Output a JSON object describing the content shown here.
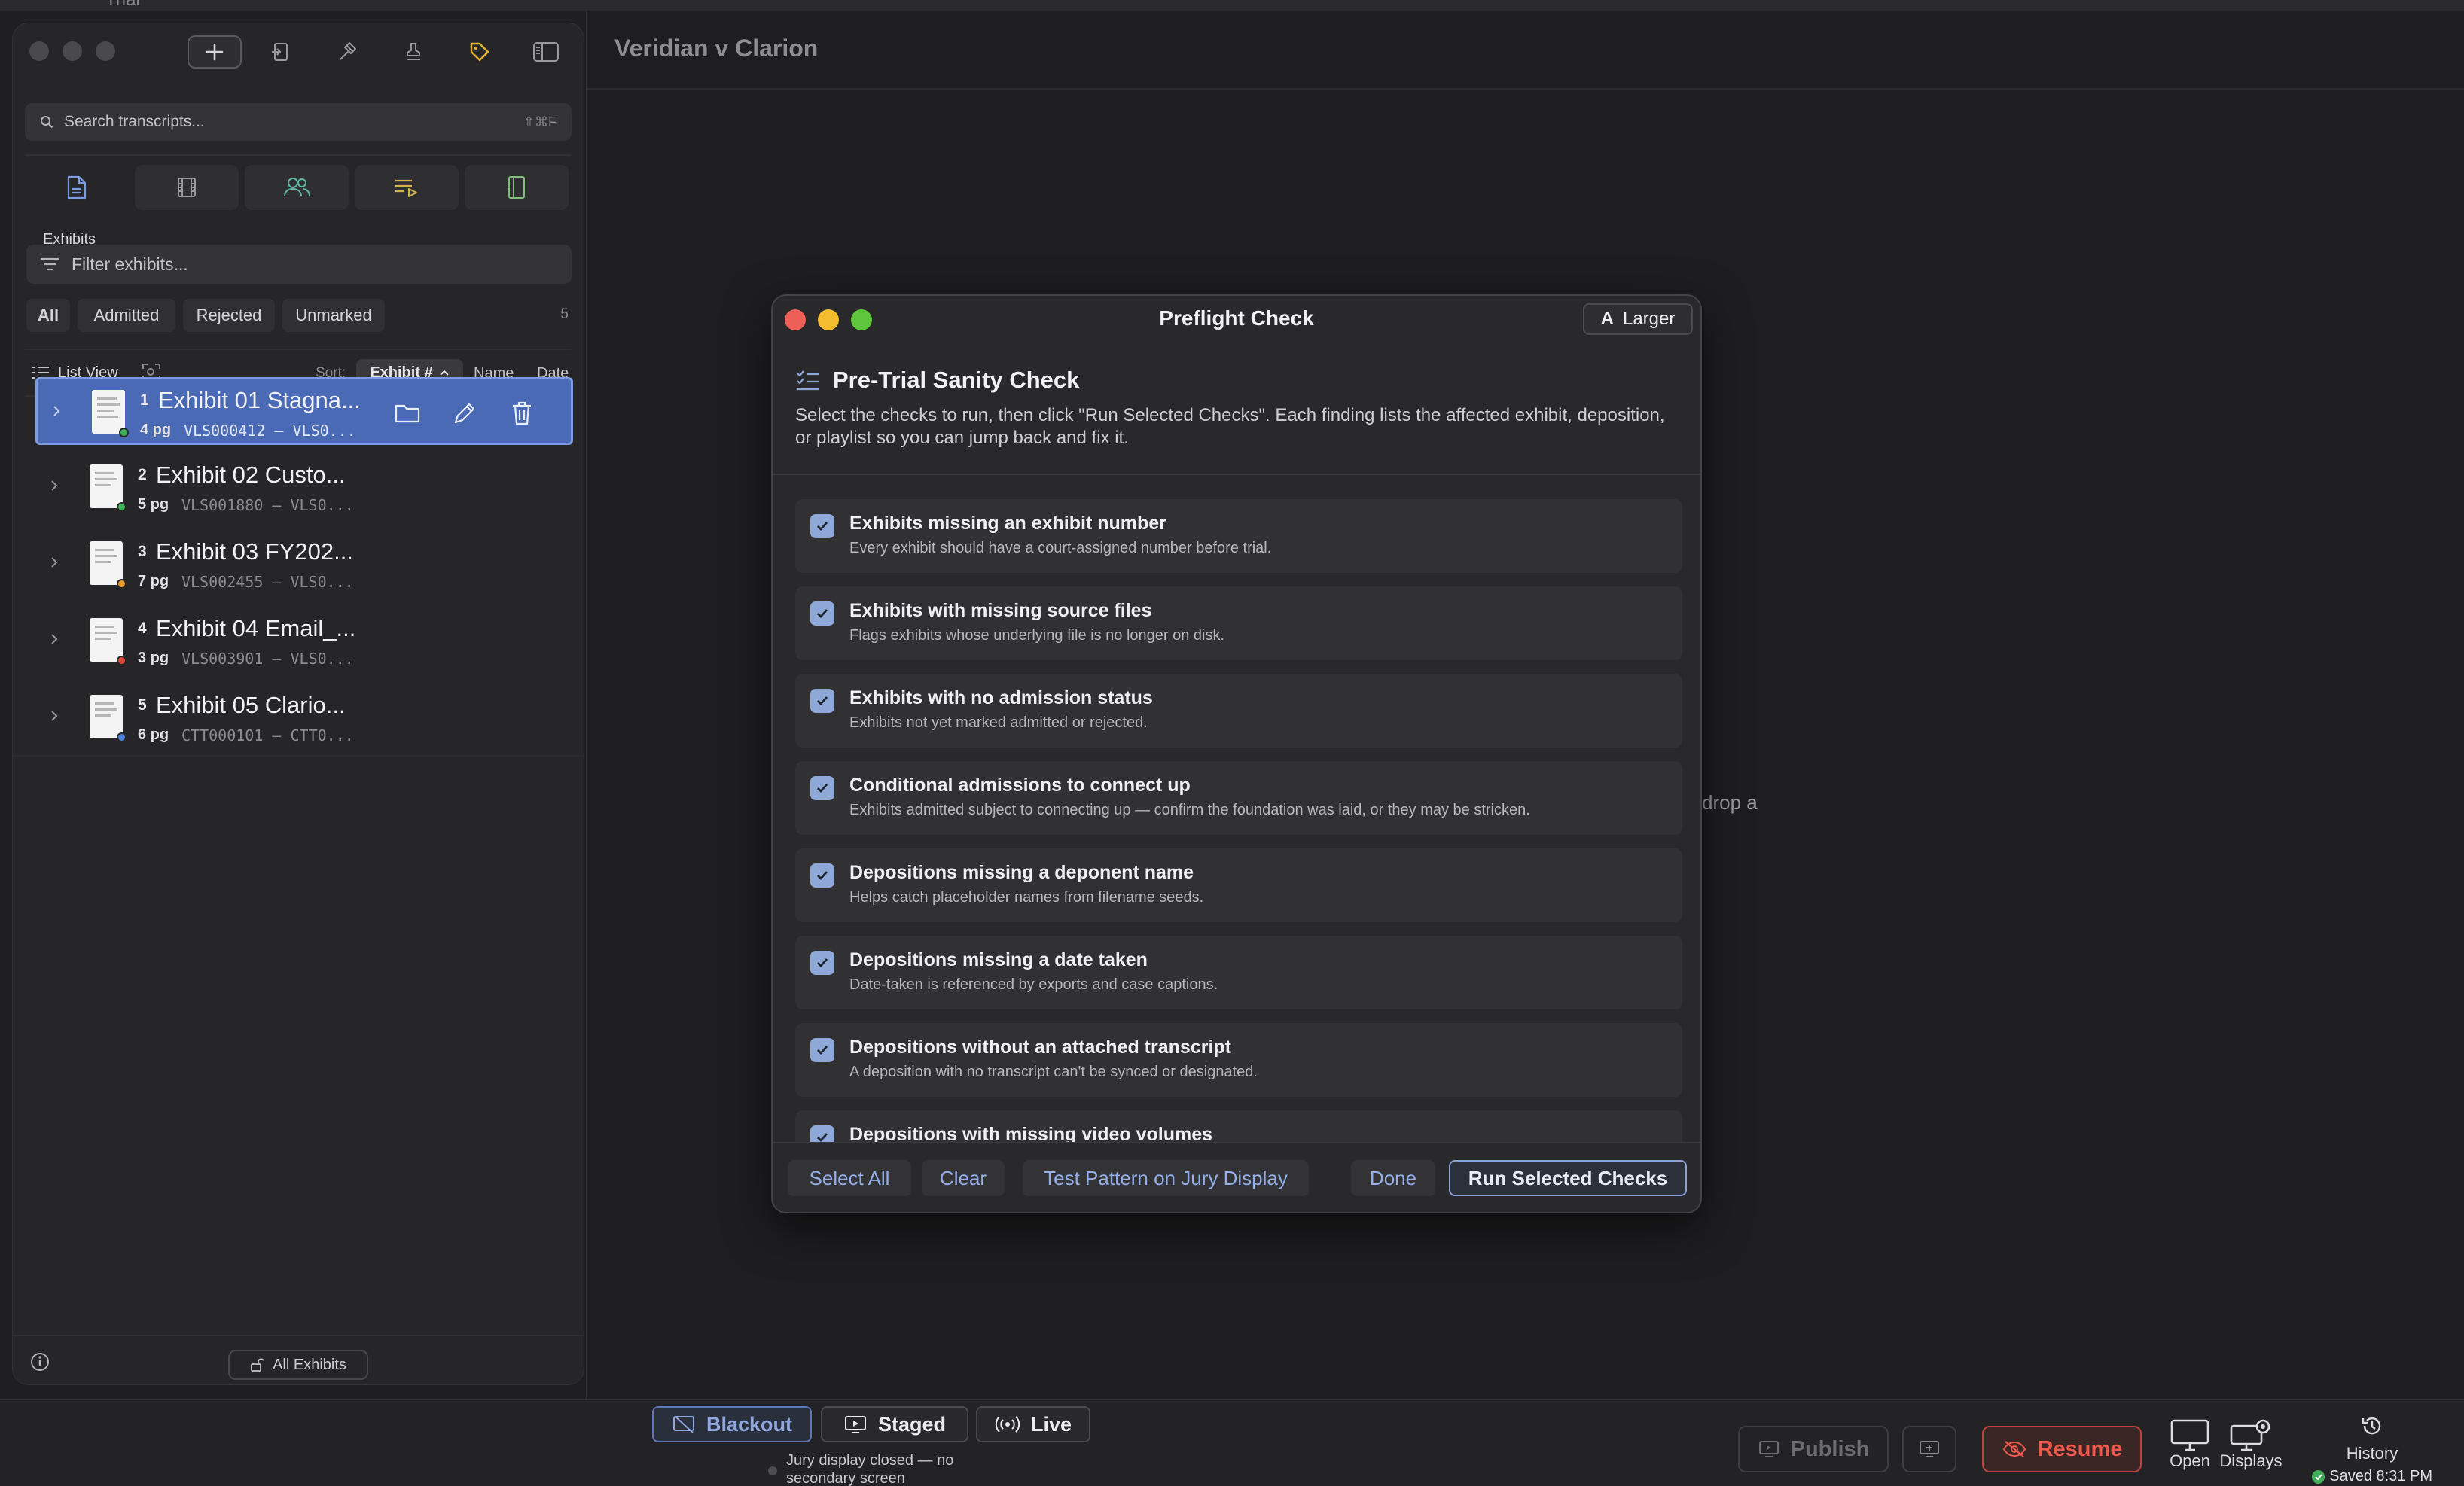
{
  "window": {
    "title_fragment": "Trial"
  },
  "toolbar": {
    "buttons": [
      "add",
      "import",
      "mark",
      "stamp",
      "tag",
      "sidebar-toggle"
    ]
  },
  "search": {
    "placeholder": "Search transcripts...",
    "shortcut": "⇧⌘F"
  },
  "tabs": {
    "active_label": "Exhibits",
    "items": [
      "exhibits",
      "clips",
      "witnesses",
      "playlists",
      "notebook"
    ]
  },
  "filter": {
    "placeholder": "Filter exhibits..."
  },
  "chips": {
    "items": [
      "All",
      "Admitted",
      "Rejected",
      "Unmarked"
    ],
    "count": "5"
  },
  "listbar": {
    "view_label": "List View",
    "sort_label": "Sort:",
    "sort_active": "Exhibit #",
    "sort_name": "Name",
    "sort_date": "Date"
  },
  "exhibits": [
    {
      "num": "1",
      "title": "Exhibit 01 Stagna...",
      "pages": "4 pg",
      "bates": "VLS000412 — VLS0...",
      "status_color": "#3fae58",
      "selected": true
    },
    {
      "num": "2",
      "title": "Exhibit 02 Custo...",
      "pages": "5 pg",
      "bates": "VLS001880 — VLS0...",
      "status_color": "#3fae58",
      "selected": false
    },
    {
      "num": "3",
      "title": "Exhibit 03 FY202...",
      "pages": "7 pg",
      "bates": "VLS002455 — VLS0...",
      "status_color": "#e59a2e",
      "selected": false
    },
    {
      "num": "4",
      "title": "Exhibit 04 Email_...",
      "pages": "3 pg",
      "bates": "VLS003901 — VLS0...",
      "status_color": "#e0443a",
      "selected": false
    },
    {
      "num": "5",
      "title": "Exhibit 05 Clario...",
      "pages": "6 pg",
      "bates": "CTT000101 — CTT0...",
      "status_color": "#4a7fd8",
      "selected": false
    }
  ],
  "sidebar_footer": {
    "all_exhibits": "All Exhibits"
  },
  "main": {
    "title": "Veridian v Clarion",
    "drop_hint": "drop a"
  },
  "dialog": {
    "title": "Preflight Check",
    "larger_label": "Larger",
    "heading": "Pre-Trial Sanity Check",
    "description": "Select the checks to run, then click \"Run Selected Checks\". Each finding lists the affected exhibit, deposition, or playlist so you can jump back and fix it.",
    "checks": [
      {
        "title": "Exhibits missing an exhibit number",
        "desc": "Every exhibit should have a court-assigned number before trial.",
        "checked": true
      },
      {
        "title": "Exhibits with missing source files",
        "desc": "Flags exhibits whose underlying file is no longer on disk.",
        "checked": true
      },
      {
        "title": "Exhibits with no admission status",
        "desc": "Exhibits not yet marked admitted or rejected.",
        "checked": true
      },
      {
        "title": "Conditional admissions to connect up",
        "desc": "Exhibits admitted subject to connecting up — confirm the foundation was laid, or they may be stricken.",
        "checked": true
      },
      {
        "title": "Depositions missing a deponent name",
        "desc": "Helps catch placeholder names from filename seeds.",
        "checked": true
      },
      {
        "title": "Depositions missing a date taken",
        "desc": "Date-taken is referenced by exports and case captions.",
        "checked": true
      },
      {
        "title": "Depositions without an attached transcript",
        "desc": "A deposition with no transcript can't be synced or designated.",
        "checked": true
      },
      {
        "title": "Depositions with missing video volumes",
        "desc": "",
        "checked": true
      }
    ],
    "footer": {
      "select_all": "Select All",
      "clear": "Clear",
      "test_pattern": "Test Pattern on Jury Display",
      "done": "Done",
      "run": "Run Selected Checks"
    }
  },
  "bottombar": {
    "modes": [
      {
        "label": "Blackout",
        "active": true
      },
      {
        "label": "Staged",
        "active": false
      },
      {
        "label": "Live",
        "active": false
      }
    ],
    "jury_status_line1": "Jury display closed — no",
    "jury_status_line2": "secondary screen",
    "publish": "Publish",
    "resume": "Resume",
    "open": "Open",
    "displays": "Displays",
    "history": "History",
    "saved": "Saved 8:31 PM"
  },
  "colors": {
    "accent": "#4a6ab5",
    "danger": "#ec5a4e",
    "success": "#3fae58",
    "close": "#ee5f57",
    "minimize": "#f4bd2f",
    "zoom": "#5fc73e"
  }
}
